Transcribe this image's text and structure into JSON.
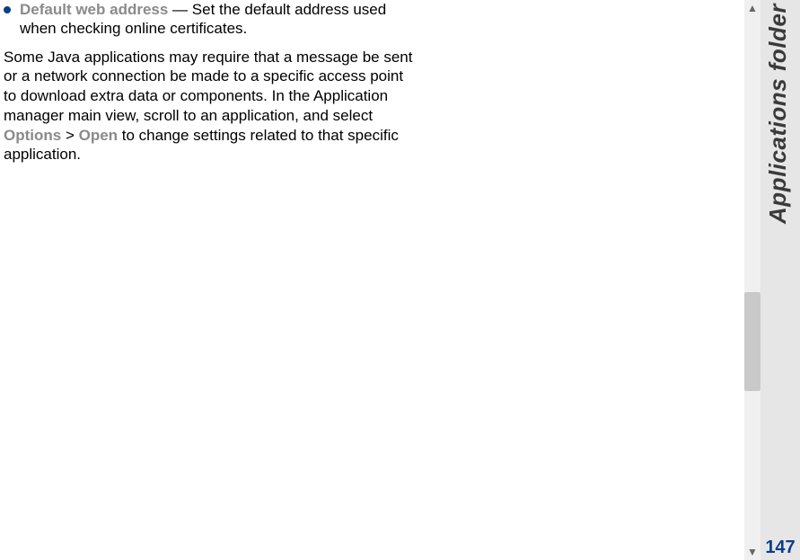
{
  "bullet": {
    "term": "Default web address",
    "dash": " — ",
    "desc": "Set the default address used when checking online certificates."
  },
  "para": {
    "t1": "Some Java applications may require that a message be sent or a network connection be made to a specific access point to download extra data or components. In the Application manager main view, scroll to an application, and select ",
    "opt": "Options",
    "gt": " > ",
    "open": "Open",
    "t2": " to change settings related to that specific application."
  },
  "side": {
    "label": "Applications folder",
    "page": "147"
  },
  "scroll": {
    "up": "▲",
    "down": "▼"
  }
}
